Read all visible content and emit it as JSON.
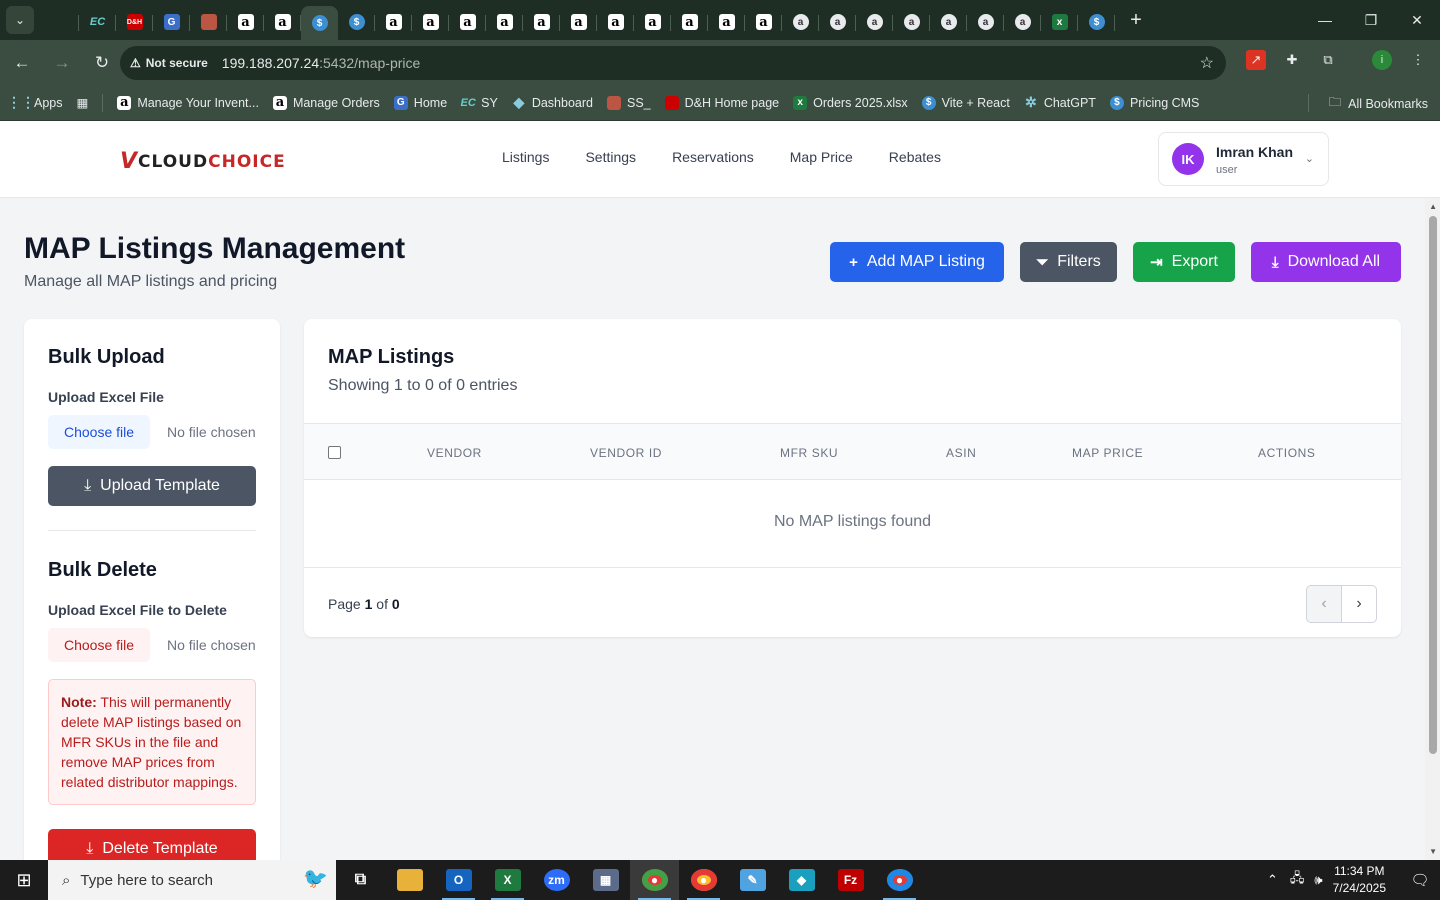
{
  "browser": {
    "tabs": [
      {
        "icon": "kite-icon"
      },
      {
        "icon": "ec-icon",
        "text": "EC"
      },
      {
        "icon": "dh-icon",
        "text": "D&H"
      },
      {
        "icon": "g-icon",
        "text": "G"
      },
      {
        "icon": "box-icon"
      },
      {
        "icon": "amazon-icon",
        "text": "a"
      },
      {
        "icon": "amazon-icon",
        "text": "a"
      },
      {
        "icon": "dollar-icon",
        "text": "$",
        "active": true
      },
      {
        "icon": "dollar-icon",
        "text": "$"
      },
      {
        "icon": "amazon-icon",
        "text": "a"
      },
      {
        "icon": "amazon-icon",
        "text": "a"
      },
      {
        "icon": "amazon-icon",
        "text": "a"
      },
      {
        "icon": "amazon-icon",
        "text": "a"
      },
      {
        "icon": "amazon-icon",
        "text": "a"
      },
      {
        "icon": "amazon-icon",
        "text": "a"
      },
      {
        "icon": "amazon-icon",
        "text": "a"
      },
      {
        "icon": "amazon-icon",
        "text": "a"
      },
      {
        "icon": "amazon-icon",
        "text": "a"
      },
      {
        "icon": "amazon-icon",
        "text": "a"
      },
      {
        "icon": "amazon-icon",
        "text": "a"
      },
      {
        "icon": "amazon-circle-icon",
        "text": "a"
      },
      {
        "icon": "amazon-circle-icon",
        "text": "a"
      },
      {
        "icon": "amazon-circle-icon",
        "text": "a"
      },
      {
        "icon": "amazon-circle-icon",
        "text": "a"
      },
      {
        "icon": "amazon-circle-icon",
        "text": "a"
      },
      {
        "icon": "amazon-circle-icon",
        "text": "a"
      },
      {
        "icon": "amazon-circle-icon",
        "text": "a"
      },
      {
        "icon": "excel-icon",
        "text": "x"
      },
      {
        "icon": "dollar-icon",
        "text": "$"
      }
    ],
    "not_secure": "Not secure",
    "url_host": "199.188.207.24",
    "url_path": ":5432/map-price",
    "bookmarks": [
      {
        "label": "Apps",
        "icon": "apps-icon"
      },
      {
        "label": "Manage Your Invent...",
        "icon": "amazon-icon"
      },
      {
        "label": "Manage Orders",
        "icon": "amazon-icon"
      },
      {
        "label": "Home",
        "icon": "g-icon"
      },
      {
        "label": "SY",
        "icon": "ec-icon"
      },
      {
        "label": "Dashboard",
        "icon": "kite-icon"
      },
      {
        "label": "SS_",
        "icon": "box-icon"
      },
      {
        "label": "D&H Home page",
        "icon": "dh-icon"
      },
      {
        "label": "Orders 2025.xlsx",
        "icon": "excel-icon"
      },
      {
        "label": "Vite + React",
        "icon": "dollar-icon"
      },
      {
        "label": "ChatGPT",
        "icon": "chatgpt-icon"
      },
      {
        "label": "Pricing CMS",
        "icon": "dollar-icon"
      }
    ],
    "all_bookmarks": "All Bookmarks"
  },
  "app": {
    "logo_v": "V",
    "logo_cloud": "cloud",
    "logo_choice": "choice",
    "nav": [
      "Listings",
      "Settings",
      "Reservations",
      "Map Price",
      "Rebates"
    ],
    "user": {
      "initials": "IK",
      "name": "Imran Khan",
      "role": "user"
    }
  },
  "page": {
    "title": "MAP Listings Management",
    "subtitle": "Manage all MAP listings and pricing",
    "buttons": {
      "add": "Add MAP Listing",
      "filters": "Filters",
      "export": "Export",
      "download": "Download All"
    }
  },
  "bulk_upload": {
    "title": "Bulk Upload",
    "label": "Upload Excel File",
    "choose": "Choose file",
    "no_file": "No file chosen",
    "button": "Upload Template"
  },
  "bulk_delete": {
    "title": "Bulk Delete",
    "label": "Upload Excel File to Delete",
    "choose": "Choose file",
    "no_file": "No file chosen",
    "note_label": "Note:",
    "note_text": " This will permanently delete MAP listings based on MFR SKUs in the file and remove MAP prices from related distributor mappings.",
    "button": "Delete Template"
  },
  "listings": {
    "title": "MAP Listings",
    "showing": "Showing 1 to 0 of 0 entries",
    "columns": [
      "VENDOR",
      "VENDOR ID",
      "MFR SKU",
      "ASIN",
      "MAP PRICE",
      "ACTIONS"
    ],
    "empty": "No MAP listings found",
    "page_prefix": "Page ",
    "page_current": "1",
    "page_of": " of ",
    "page_total": "0"
  },
  "taskbar": {
    "search_placeholder": "Type here to search",
    "time": "11:34 PM",
    "date": "7/24/2025"
  },
  "colors": {
    "primary": "#2563eb",
    "gray": "#4b5563",
    "green": "#16a34a",
    "purple": "#9333ea",
    "danger": "#dc2626"
  }
}
